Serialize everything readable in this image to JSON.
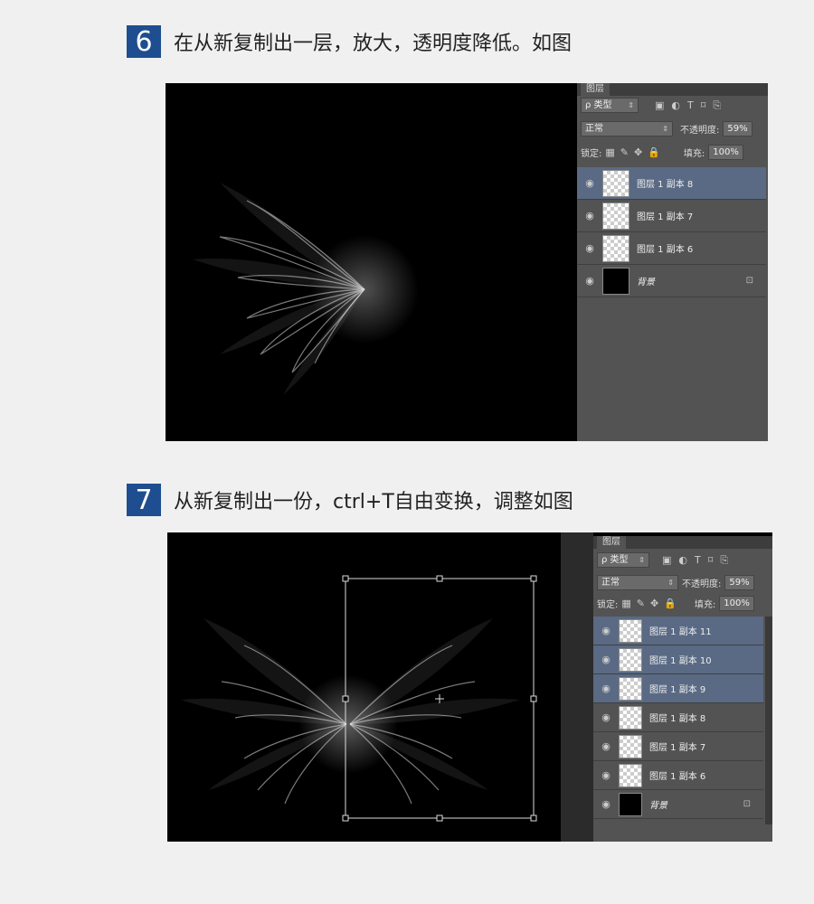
{
  "steps": [
    {
      "number": "6",
      "text": "在从新复制出一层，放大，透明度降低。如图"
    },
    {
      "number": "7",
      "text": "从新复制出一份，ctrl+T自由变换，调整如图"
    }
  ],
  "panel1": {
    "tab": "图层",
    "filter": "ρ 类型",
    "filter_icons": [
      "▣",
      "◐",
      "T",
      "⌑",
      "⎘"
    ],
    "blend_mode": "正常",
    "opacity_label": "不透明度:",
    "opacity_value": "59%",
    "lock_label": "锁定:",
    "lock_icons": [
      "▦",
      "✎",
      "✥",
      "🔒"
    ],
    "fill_label": "填充:",
    "fill_value": "100%",
    "layers": [
      {
        "name": "图层 1 副本 8",
        "selected": true,
        "thumb": "checker"
      },
      {
        "name": "图层 1 副本 7",
        "selected": false,
        "thumb": "checker"
      },
      {
        "name": "图层 1 副本 6",
        "selected": false,
        "thumb": "checker"
      },
      {
        "name": "背景",
        "selected": false,
        "thumb": "black",
        "locked": true
      }
    ]
  },
  "panel2": {
    "tab": "图层",
    "filter": "ρ 类型",
    "filter_icons": [
      "▣",
      "◐",
      "T",
      "⌑",
      "⎘"
    ],
    "blend_mode": "正常",
    "opacity_label": "不透明度:",
    "opacity_value": "59%",
    "lock_label": "锁定:",
    "lock_icons": [
      "▦",
      "✎",
      "✥",
      "🔒"
    ],
    "fill_label": "填充:",
    "fill_value": "100%",
    "layers": [
      {
        "name": "图层 1 副本 11",
        "selected": true,
        "thumb": "checker"
      },
      {
        "name": "图层 1 副本 10",
        "selected": true,
        "thumb": "checker"
      },
      {
        "name": "图层 1 副本 9",
        "selected": true,
        "thumb": "checker"
      },
      {
        "name": "图层 1 副本 8",
        "selected": false,
        "thumb": "checker"
      },
      {
        "name": "图层 1 副本 7",
        "selected": false,
        "thumb": "checker"
      },
      {
        "name": "图层 1 副本 6",
        "selected": false,
        "thumb": "checker"
      },
      {
        "name": "背景",
        "selected": false,
        "thumb": "black",
        "locked": true
      }
    ]
  },
  "icons": {
    "eye": "eye-icon",
    "lock": "lock-icon"
  },
  "colors": {
    "step_badge": "#1e4e8f",
    "panel_bg": "#535353",
    "selected_layer": "#5a6a84"
  }
}
